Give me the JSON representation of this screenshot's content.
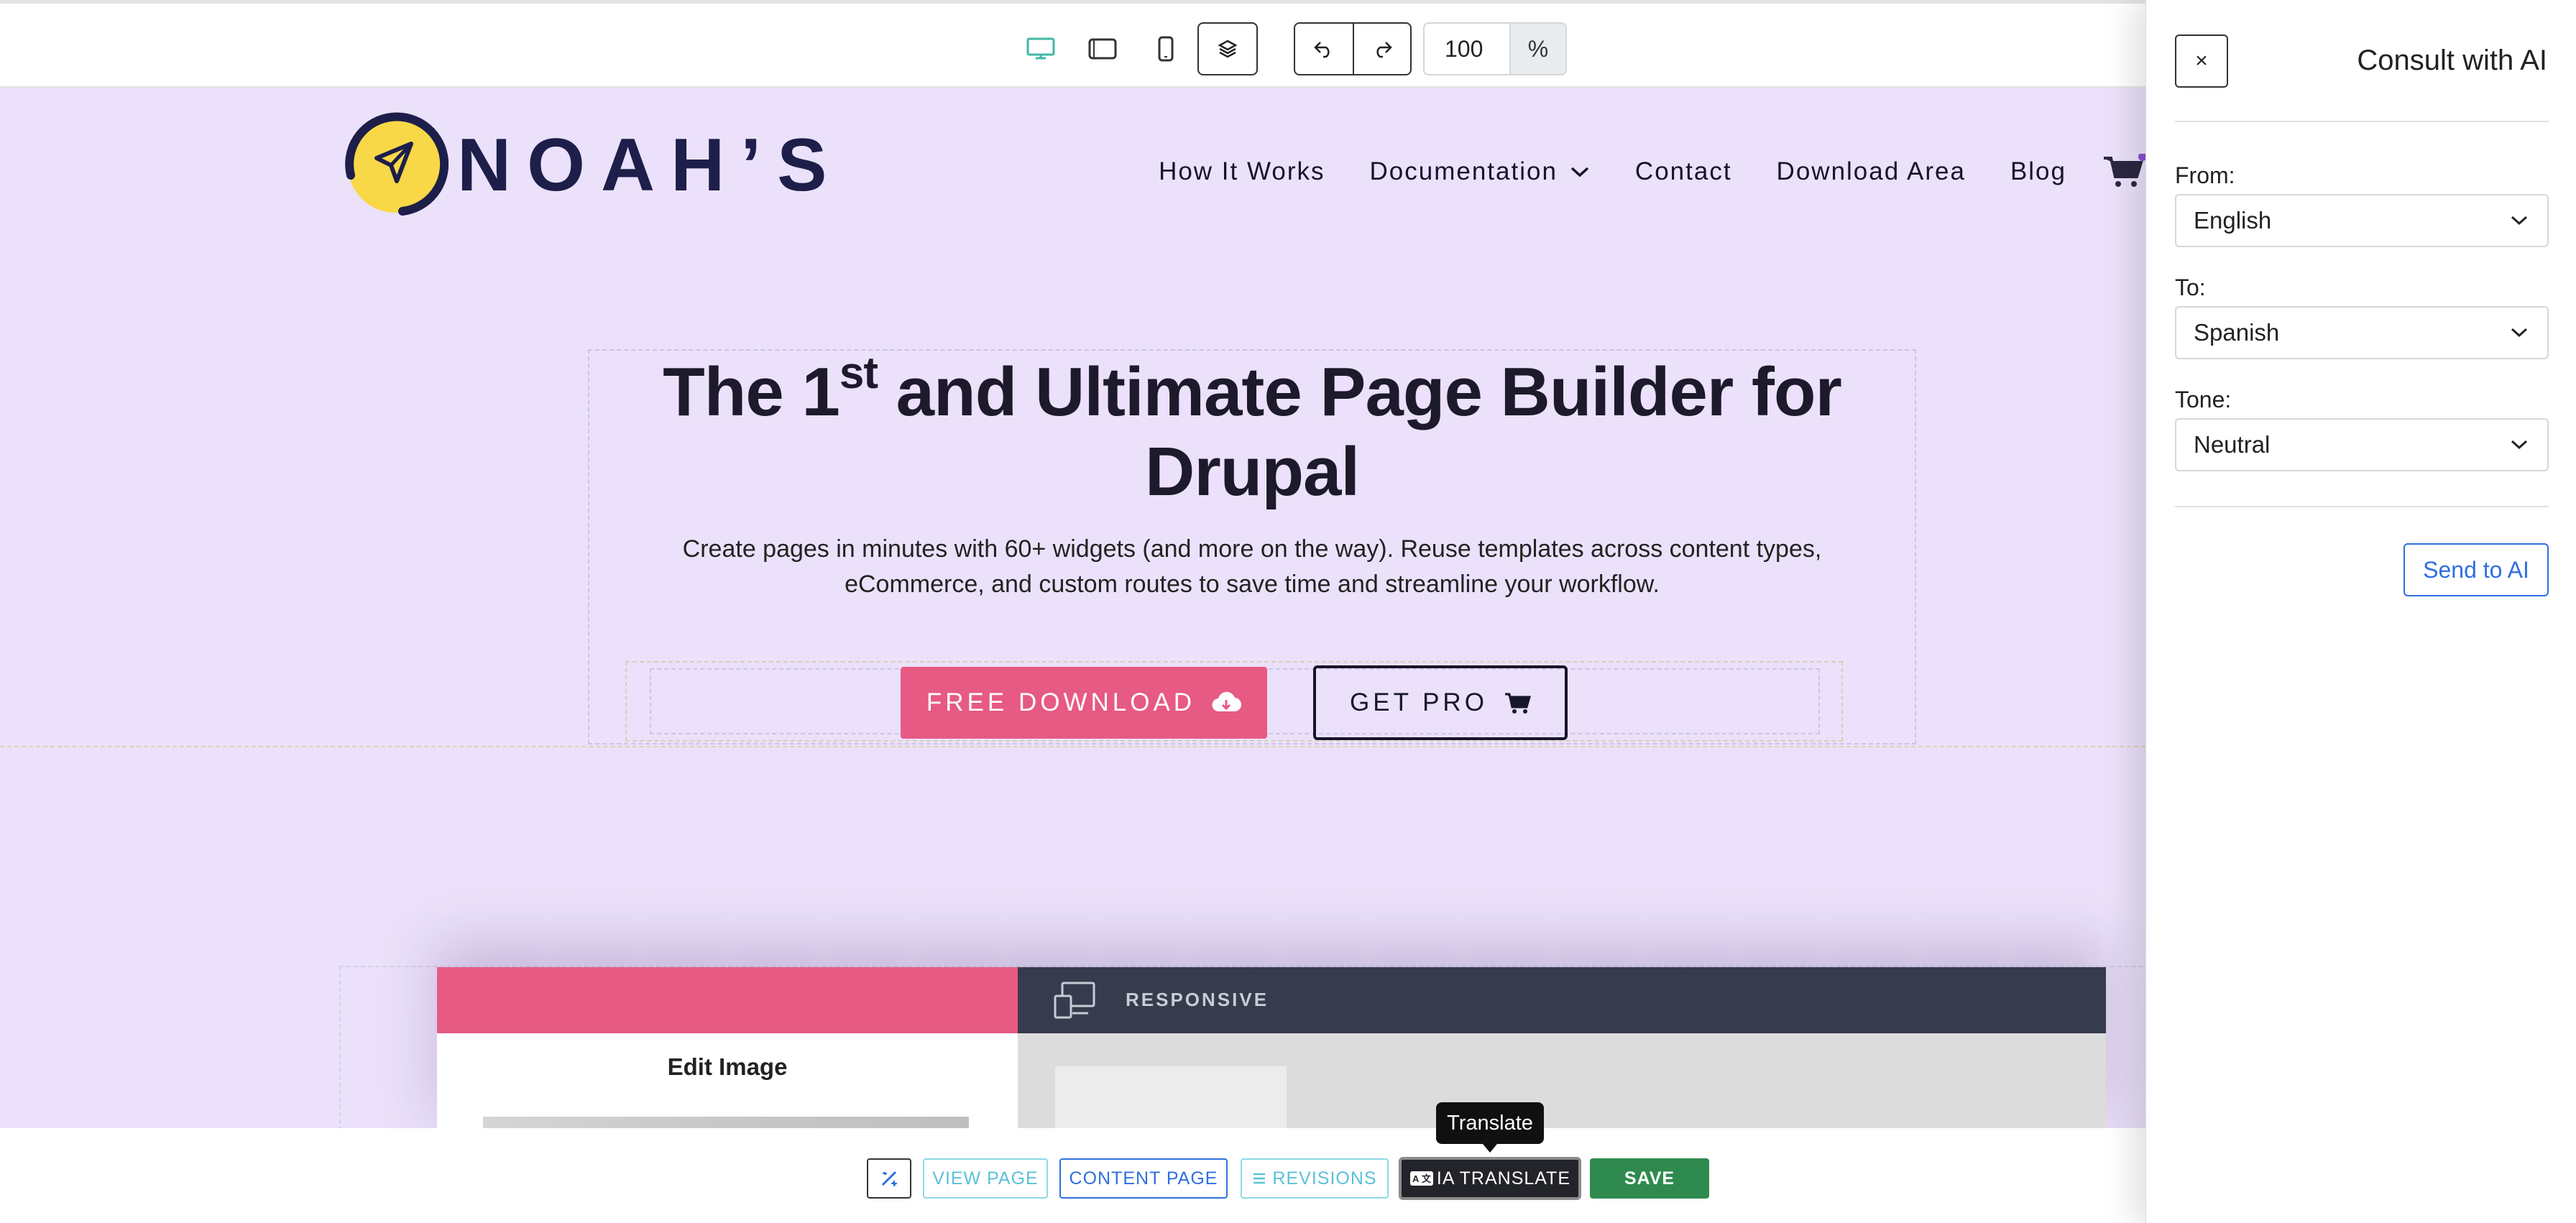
{
  "toolbar": {
    "zoom_value": "100",
    "zoom_unit": "%"
  },
  "site": {
    "logo_text": "NOAH’S",
    "nav": [
      {
        "label": "How It Works"
      },
      {
        "label": "Documentation"
      },
      {
        "label": "Contact"
      },
      {
        "label": "Download Area"
      },
      {
        "label": "Blog"
      }
    ],
    "hero": {
      "title_pre": "The 1",
      "title_sup": "st",
      "title_post": " and Ultimate Page Builder for Drupal",
      "subtitle": "Create pages in minutes with 60+ widgets (and more on the way). Reuse templates across content types, eCommerce, and custom routes to save time and streamline your workflow."
    },
    "buttons": {
      "free_download": "FREE DOWNLOAD",
      "get_pro": "GET PRO"
    },
    "mockup": {
      "edit_image_title": "Edit Image",
      "responsive_label": "RESPONSIVE"
    }
  },
  "bottom_bar": {
    "view_page": "VIEW PAGE",
    "content_page": "CONTENT PAGE",
    "revisions": "REVISIONS",
    "ia_translate": "IA TRANSLATE",
    "save": "SAVE",
    "tooltip": "Translate"
  },
  "ai_panel": {
    "close": "×",
    "title": "Consult with AI",
    "from_label": "From:",
    "from_value": "English",
    "to_label": "To:",
    "to_value": "Spanish",
    "tone_label": "Tone:",
    "tone_value": "Neutral",
    "send": "Send to AI"
  },
  "colors": {
    "accent_pink": "#e65a83",
    "canvas_bg": "#ebe1fa",
    "save_green": "#2f8a4f",
    "link_blue": "#2f6fe0",
    "active_device": "#3fb8a5"
  },
  "icons": [
    "desktop-icon",
    "tablet-icon",
    "mobile-icon",
    "layers-icon",
    "undo-icon",
    "redo-icon",
    "cart-icon",
    "cloud-download-icon",
    "magic-icon",
    "revisions-icon",
    "translate-icon",
    "chevron-down-icon",
    "responsive-icon"
  ]
}
